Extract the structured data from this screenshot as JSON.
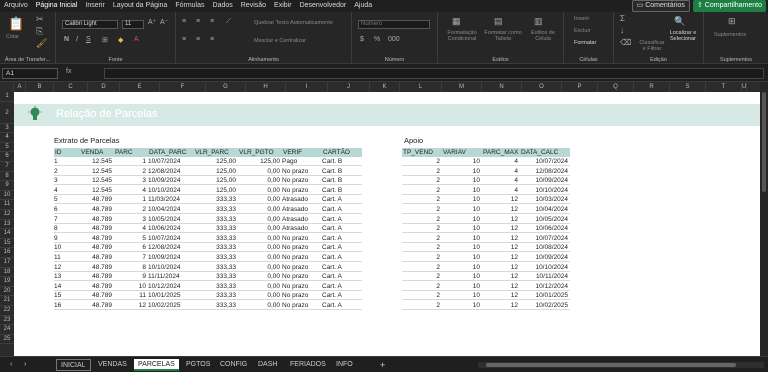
{
  "menu": {
    "items": [
      "Arquivo",
      "Página Inicial",
      "Inserir",
      "Layout da Página",
      "Fórmulas",
      "Dados",
      "Revisão",
      "Exibir",
      "Desenvolvedor",
      "Ajuda"
    ],
    "comments_label": "Comentários",
    "share_label": "Compartilhamento"
  },
  "ribbon": {
    "clipboard_label": "Área de Transfer...",
    "paste_label": "Colar",
    "font_name": "Calibri Light",
    "font_size": "11",
    "font_label": "Fonte",
    "wrap_label": "Quebrar Texto Automaticamente",
    "merge_label": "Mesclar e Centralizar",
    "alignment_label": "Alinhamento",
    "number_format": "Número",
    "number_label": "Número",
    "cond_format_label": "Formatação Condicional",
    "format_table_label": "Formatar como Tabela",
    "cell_styles_label": "Estilos de Célula",
    "styles_label": "Estilos",
    "insert_label": "Inserir",
    "delete_label": "Excluir",
    "format_label": "Formatar",
    "cells_label": "Células",
    "sort_label": "Classificar e Filtrar",
    "find_label": "Localizar e Selecionar",
    "edit_label": "Edição",
    "addins_label": "Suplementos",
    "addins_group_label": "Suplementos"
  },
  "formula_bar": {
    "cell_ref": "A1",
    "fx": "fx",
    "content": ""
  },
  "columns": [
    "A",
    "B",
    "C",
    "D",
    "E",
    "F",
    "G",
    "H",
    "I",
    "J",
    "K",
    "L",
    "M",
    "N",
    "O",
    "P",
    "Q",
    "R",
    "S",
    "T",
    "U"
  ],
  "rows": [
    "1",
    "2",
    "3",
    "4",
    "5",
    "6",
    "7",
    "8",
    "9",
    "10",
    "11",
    "12",
    "13",
    "14",
    "15",
    "16",
    "17",
    "18",
    "19",
    "20",
    "21",
    "22",
    "23",
    "24",
    "25"
  ],
  "sheet": {
    "title": "Relação de Parcelas",
    "left_section": "Extrato de Parcelas",
    "right_section": "Apoio",
    "left_headers": [
      "ID",
      "VENDA",
      "PARC",
      "DATA_PARC",
      "VLR_PARC",
      "VLR_PGTO",
      "VERIF",
      "CARTÃO"
    ],
    "left_rows": [
      [
        "1",
        "12.545",
        "1",
        "10/07/2024",
        "125,00",
        "125,00",
        "Pago",
        "Cart. B"
      ],
      [
        "2",
        "12.545",
        "2",
        "12/08/2024",
        "125,00",
        "0,00",
        "No prazo",
        "Cart. B"
      ],
      [
        "3",
        "12.545",
        "3",
        "10/09/2024",
        "125,00",
        "0,00",
        "No prazo",
        "Cart. B"
      ],
      [
        "4",
        "12.545",
        "4",
        "10/10/2024",
        "125,00",
        "0,00",
        "No prazo",
        "Cart. B"
      ],
      [
        "5",
        "48.789",
        "1",
        "11/03/2024",
        "333,33",
        "0,00",
        "Atrasado",
        "Cart. A"
      ],
      [
        "6",
        "48.789",
        "2",
        "10/04/2024",
        "333,33",
        "0,00",
        "Atrasado",
        "Cart. A"
      ],
      [
        "7",
        "48.789",
        "3",
        "10/05/2024",
        "333,33",
        "0,00",
        "Atrasado",
        "Cart. A"
      ],
      [
        "8",
        "48.789",
        "4",
        "10/06/2024",
        "333,33",
        "0,00",
        "Atrasado",
        "Cart. A"
      ],
      [
        "9",
        "48.789",
        "5",
        "10/07/2024",
        "333,33",
        "0,00",
        "No prazo",
        "Cart. A"
      ],
      [
        "10",
        "48.789",
        "6",
        "12/08/2024",
        "333,33",
        "0,00",
        "No prazo",
        "Cart. A"
      ],
      [
        "11",
        "48.789",
        "7",
        "10/09/2024",
        "333,33",
        "0,00",
        "No prazo",
        "Cart. A"
      ],
      [
        "12",
        "48.789",
        "8",
        "10/10/2024",
        "333,33",
        "0,00",
        "No prazo",
        "Cart. A"
      ],
      [
        "13",
        "48.789",
        "9",
        "11/11/2024",
        "333,33",
        "0,00",
        "No prazo",
        "Cart. A"
      ],
      [
        "14",
        "48.789",
        "10",
        "10/12/2024",
        "333,33",
        "0,00",
        "No prazo",
        "Cart. A"
      ],
      [
        "15",
        "48.789",
        "11",
        "10/01/2025",
        "333,33",
        "0,00",
        "No prazo",
        "Cart. A"
      ],
      [
        "16",
        "48.789",
        "12",
        "10/02/2025",
        "333,33",
        "0,00",
        "No prazo",
        "Cart. A"
      ]
    ],
    "right_headers": [
      "TP_VEND",
      "VARIAV",
      "PARC_MAX",
      "DATA_CALC"
    ],
    "right_rows": [
      [
        "2",
        "10",
        "4",
        "10/07/2024"
      ],
      [
        "2",
        "10",
        "4",
        "12/08/2024"
      ],
      [
        "2",
        "10",
        "4",
        "10/09/2024"
      ],
      [
        "2",
        "10",
        "4",
        "10/10/2024"
      ],
      [
        "2",
        "10",
        "12",
        "10/03/2024"
      ],
      [
        "2",
        "10",
        "12",
        "10/04/2024"
      ],
      [
        "2",
        "10",
        "12",
        "10/05/2024"
      ],
      [
        "2",
        "10",
        "12",
        "10/06/2024"
      ],
      [
        "2",
        "10",
        "12",
        "10/07/2024"
      ],
      [
        "2",
        "10",
        "12",
        "10/08/2024"
      ],
      [
        "2",
        "10",
        "12",
        "10/09/2024"
      ],
      [
        "2",
        "10",
        "12",
        "10/10/2024"
      ],
      [
        "2",
        "10",
        "12",
        "10/11/2024"
      ],
      [
        "2",
        "10",
        "12",
        "10/12/2024"
      ],
      [
        "2",
        "10",
        "12",
        "10/01/2025"
      ],
      [
        "2",
        "10",
        "12",
        "10/02/2025"
      ]
    ]
  },
  "tabs": [
    "INICIAL",
    "VENDAS",
    "PARCELAS",
    "PGTOS",
    "CONFIG",
    "DASH",
    "FERIADOS",
    "INFO"
  ],
  "add_sheet": "+",
  "colors": {
    "accent": "#1e7f45",
    "table_header": "#b8d8d3",
    "title_band": "#d6e9e5"
  }
}
